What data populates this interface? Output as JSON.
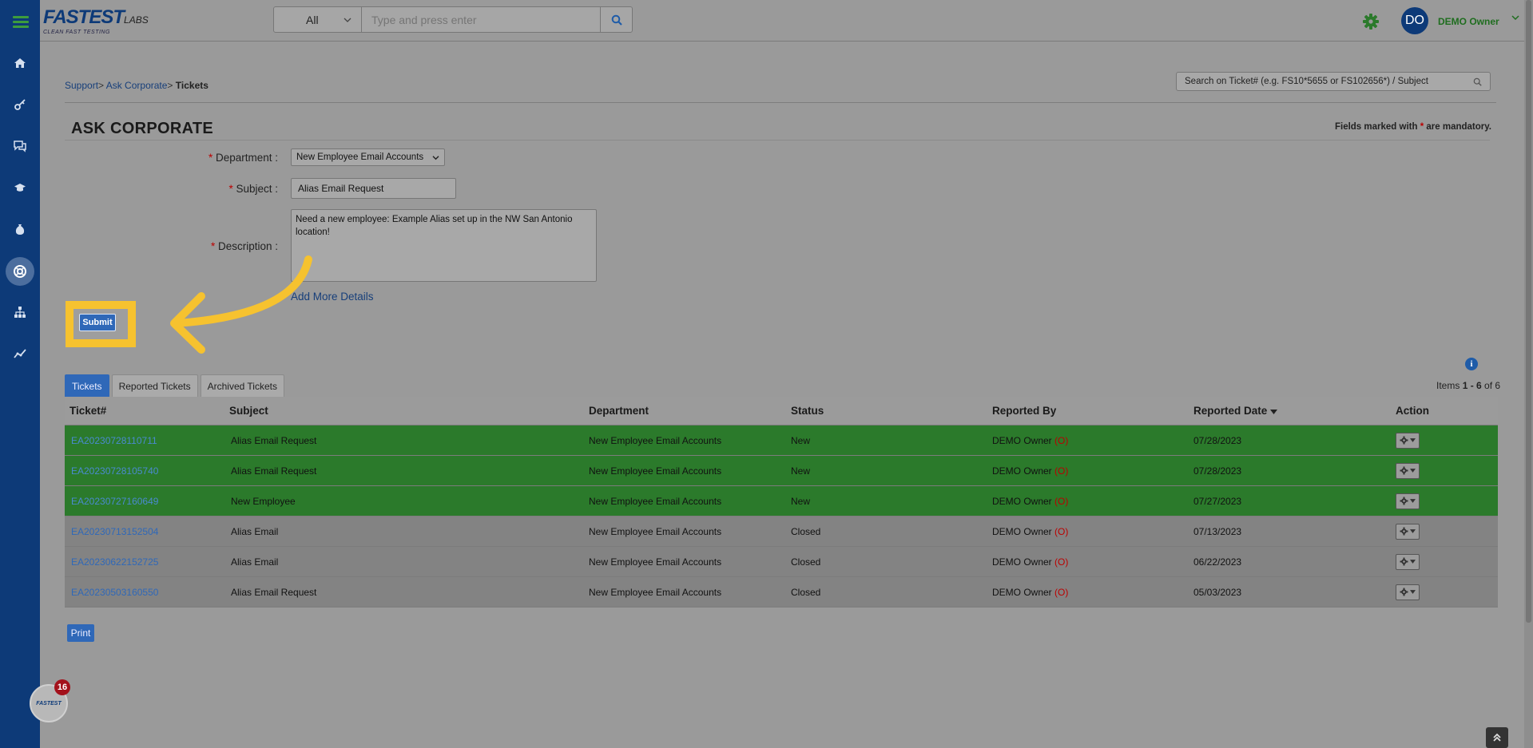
{
  "header": {
    "logo_main": "FASTEST",
    "logo_suffix": "LABS",
    "logo_tagline": "CLEAN FAST TESTING",
    "search_scope": "All",
    "search_placeholder": "Type and press enter",
    "user_initials": "DO",
    "user_name": "DEMO Owner",
    "accent_color": "#0d3a78",
    "status_green": "#2b7a2b"
  },
  "breadcrumb": {
    "support": "Support",
    "ask_corporate": "Ask Corporate",
    "current": "Tickets",
    "sep": ">"
  },
  "ticket_search": {
    "placeholder": "Search on Ticket# (e.g. FS10*5655 or FS102656*) / Subject"
  },
  "page": {
    "title": "ASK CORPORATE",
    "mandatory_prefix": "Fields marked with",
    "mandatory_star": "*",
    "mandatory_suffix": "are mandatory."
  },
  "form": {
    "department_label": "Department :",
    "department_value": "New Employee Email Accounts",
    "subject_label": "Subject :",
    "subject_value": "Alias Email Request",
    "description_label": "Description :",
    "description_value": "Need a new employee: Example Alias set up in the NW San Antonio location!",
    "add_more_label": "Add More Details",
    "submit_label": "Submit"
  },
  "tabs": [
    {
      "label": "Tickets",
      "active": true
    },
    {
      "label": "Reported Tickets",
      "active": false
    },
    {
      "label": "Archived Tickets",
      "active": false
    }
  ],
  "items_count": {
    "prefix": "Items",
    "range": "1 - 6",
    "of": "of",
    "total": "6"
  },
  "table": {
    "columns": [
      "Ticket#",
      "Subject",
      "Department",
      "Status",
      "Reported By",
      "Reported Date",
      "Action"
    ],
    "rows": [
      {
        "ticket": "EA20230728110711",
        "subject": "Alias Email Request",
        "department": "New Employee Email Accounts",
        "status": "New",
        "reported_by": "DEMO Owner",
        "reported_by_tag": "(O)",
        "date": "07/28/2023",
        "state": "green"
      },
      {
        "ticket": "EA20230728105740",
        "subject": "Alias Email Request",
        "department": "New Employee Email Accounts",
        "status": "New",
        "reported_by": "DEMO Owner",
        "reported_by_tag": "(O)",
        "date": "07/28/2023",
        "state": "green"
      },
      {
        "ticket": "EA20230727160649",
        "subject": "New Employee",
        "department": "New Employee Email Accounts",
        "status": "New",
        "reported_by": "DEMO Owner",
        "reported_by_tag": "(O)",
        "date": "07/27/2023",
        "state": "green"
      },
      {
        "ticket": "EA20230713152504",
        "subject": "Alias Email",
        "department": "New Employee Email Accounts",
        "status": "Closed",
        "reported_by": "DEMO Owner",
        "reported_by_tag": "(O)",
        "date": "07/13/2023",
        "state": "gray"
      },
      {
        "ticket": "EA20230622152725",
        "subject": "Alias Email",
        "department": "New Employee Email Accounts",
        "status": "Closed",
        "reported_by": "DEMO Owner",
        "reported_by_tag": "(O)",
        "date": "06/22/2023",
        "state": "gray"
      },
      {
        "ticket": "EA20230503160550",
        "subject": "Alias Email Request",
        "department": "New Employee Email Accounts",
        "status": "Closed",
        "reported_by": "DEMO Owner",
        "reported_by_tag": "(O)",
        "date": "05/03/2023",
        "state": "gray"
      }
    ]
  },
  "footer": {
    "print_label": "Print",
    "fab_label": "FASTEST",
    "badge_count": "16"
  },
  "sidebar": {
    "items": [
      "home-icon",
      "key-icon",
      "chat-icon",
      "graduation-cap-icon",
      "money-bag-icon",
      "support-icon",
      "org-chart-icon",
      "analytics-icon"
    ]
  }
}
